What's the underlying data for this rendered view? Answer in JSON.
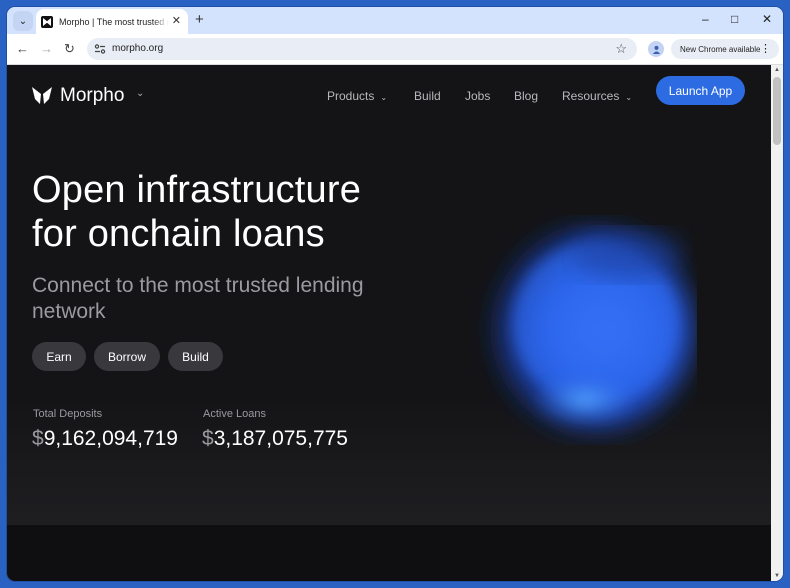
{
  "browser": {
    "tab_title": "Morpho | The most trusted network",
    "url": "morpho.org",
    "update_label": "New Chrome available"
  },
  "site": {
    "brand": "Morpho",
    "nav": {
      "products": "Products",
      "build": "Build",
      "jobs": "Jobs",
      "blog": "Blog",
      "resources": "Resources",
      "launch": "Launch App"
    },
    "hero": {
      "headline_line1": "Open infrastructure",
      "headline_line2": "for onchain loans",
      "subhead": "Connect to the most trusted lending network",
      "buttons": {
        "earn": "Earn",
        "borrow": "Borrow",
        "build": "Build"
      }
    },
    "stats": {
      "deposits_label": "Total Deposits",
      "deposits_currency": "$",
      "deposits_value": "9,162,094,719",
      "loans_label": "Active Loans",
      "loans_currency": "$",
      "loans_value": "3,187,075,775"
    }
  },
  "colors": {
    "accent": "#2d6be2",
    "page_bg": "#141416",
    "orb_blue": "#2f6bf0"
  }
}
